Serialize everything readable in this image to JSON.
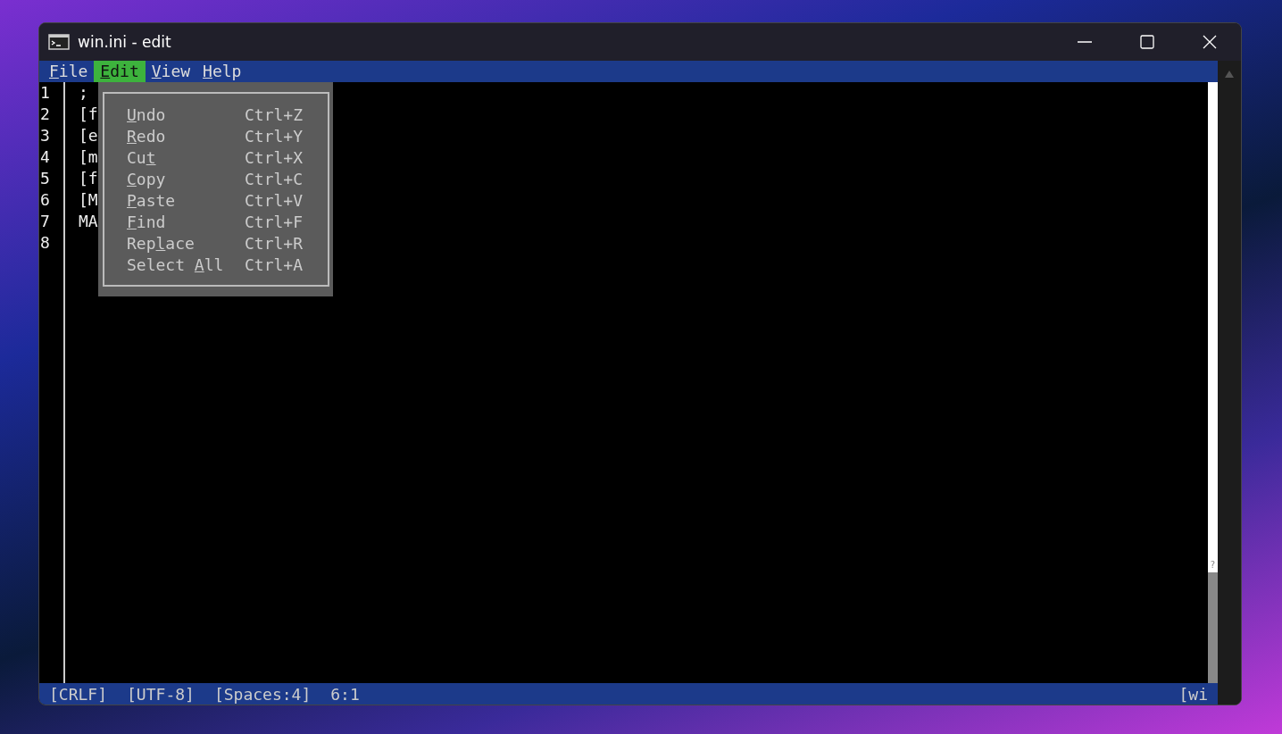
{
  "window": {
    "title": "win.ini - edit"
  },
  "menu_bar": [
    {
      "key": "F",
      "after": "ile",
      "selected": false
    },
    {
      "key": "E",
      "after": "dit",
      "selected": true
    },
    {
      "key": "V",
      "after": "iew",
      "selected": false
    },
    {
      "key": "H",
      "after": "elp",
      "selected": false
    }
  ],
  "editor": {
    "lines": [
      {
        "number": "1",
        "text": ";"
      },
      {
        "number": "2",
        "text": "[f"
      },
      {
        "number": "3",
        "text": "[e"
      },
      {
        "number": "4",
        "text": "[m"
      },
      {
        "number": "5",
        "text": "[f"
      },
      {
        "number": "6",
        "text": "[M"
      },
      {
        "number": "7",
        "text": "MA"
      },
      {
        "number": "8"
      }
    ]
  },
  "edit_menu": [
    {
      "key": "U",
      "after": "ndo",
      "shortcut": "Ctrl+Z"
    },
    {
      "key": "R",
      "after": "edo",
      "shortcut": "Ctrl+Y"
    },
    {
      "before": "Cu",
      "key": "t",
      "shortcut": "Ctrl+X"
    },
    {
      "key": "C",
      "after": "opy",
      "shortcut": "Ctrl+C"
    },
    {
      "key": "P",
      "after": "aste",
      "shortcut": "Ctrl+V"
    },
    {
      "key": "F",
      "after": "ind",
      "shortcut": "Ctrl+F"
    },
    {
      "before": "Rep",
      "key": "l",
      "after": "ace",
      "shortcut": "Ctrl+R"
    },
    {
      "before": "Select ",
      "key": "A",
      "after": "ll",
      "shortcut": "Ctrl+A"
    }
  ],
  "scrollbar_marker": "?",
  "status_bar": [
    "[CRLF]",
    "[UTF-8]",
    "[Spaces:4]",
    "6:1"
  ],
  "status_right": "[wi"
}
